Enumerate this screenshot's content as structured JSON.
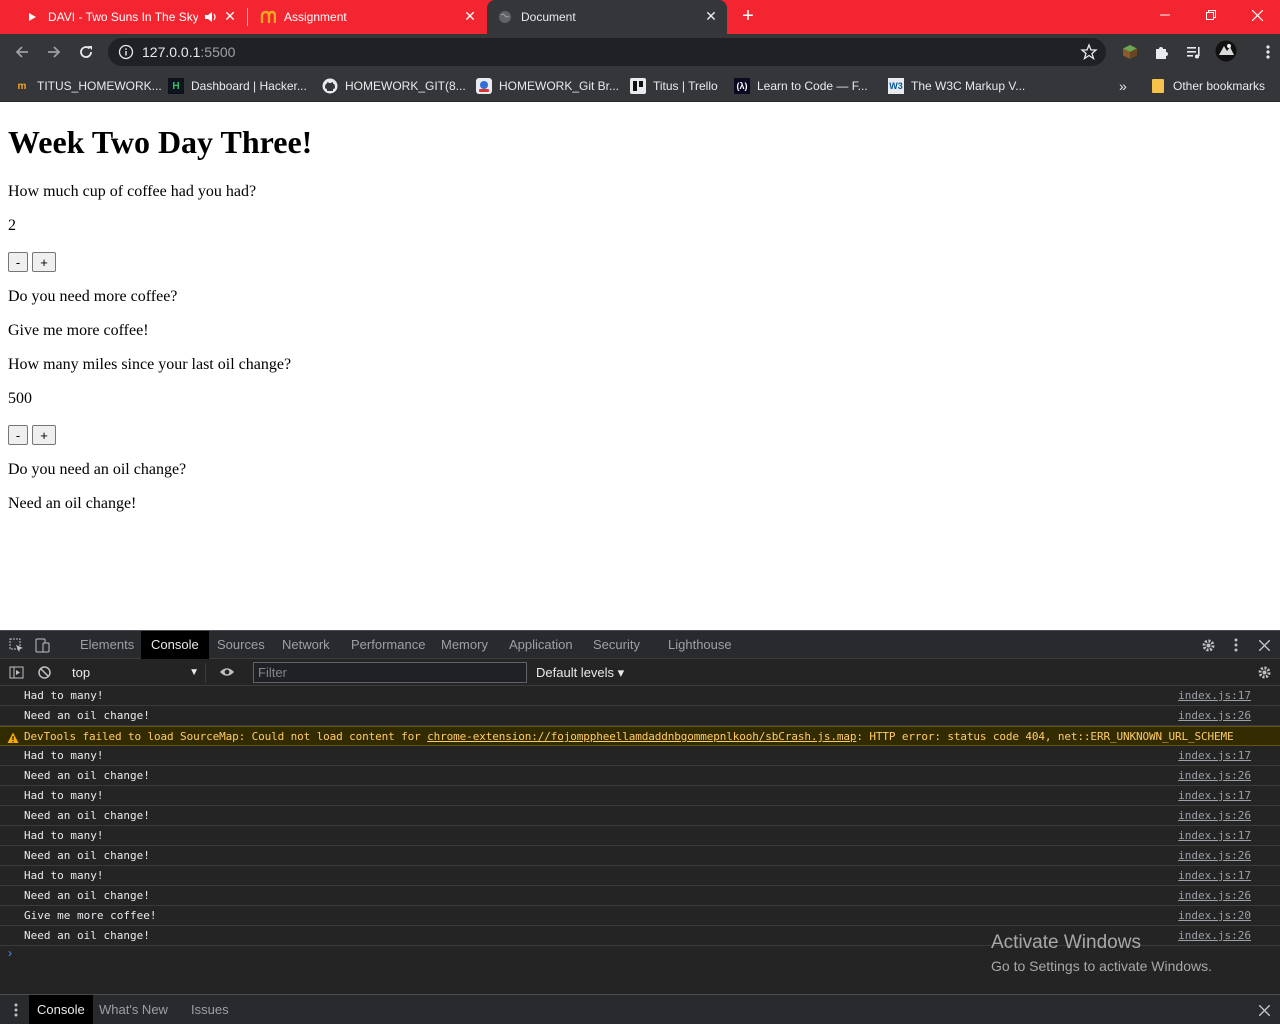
{
  "browser": {
    "tabs": [
      {
        "title": "DAVI - Two Suns In The Sky (",
        "icon": "youtube-icon",
        "audio": "speaker-icon"
      },
      {
        "title": "Assignment",
        "icon": "hackerrank-icon"
      },
      {
        "title": "Document",
        "icon": "globe-icon",
        "active": true
      }
    ],
    "address": {
      "host": "127.0.0.1",
      "port": ":5500"
    },
    "bookmarks": [
      {
        "label": "TITUS_HOMEWORK...",
        "icon": "m-logo-icon"
      },
      {
        "label": "Dashboard | Hacker...",
        "icon": "hackerrank-icon"
      },
      {
        "label": "HOMEWORK_GIT(8...",
        "icon": "github-icon"
      },
      {
        "label": "HOMEWORK_Git Br...",
        "icon": "discord-icon"
      },
      {
        "label": "Titus | Trello",
        "icon": "trello-icon"
      },
      {
        "label": "Learn to Code — F...",
        "icon": "freecodecamp-icon"
      },
      {
        "label": "The W3C Markup V...",
        "icon": "w3c-icon"
      }
    ],
    "overflow": "»",
    "other_bookmarks": "Other bookmarks"
  },
  "page": {
    "heading": "Week Two Day Three!",
    "coffee": {
      "question": "How much cup of coffee had you had?",
      "value": "2",
      "minus": "-",
      "plus": "+",
      "prompt": "Do you need more coffee?",
      "answer": "Give me more coffee!"
    },
    "oil": {
      "question": "How many miles since your last oil change?",
      "value": "500",
      "minus": "-",
      "plus": "+",
      "prompt": "Do you need an oil change?",
      "answer": "Need an oil change!"
    }
  },
  "devtools": {
    "tabs": [
      "Elements",
      "Console",
      "Sources",
      "Network",
      "Performance",
      "Memory",
      "Application",
      "Security",
      "Lighthouse"
    ],
    "active_tab": "Console",
    "context": "top",
    "filter_placeholder": "Filter",
    "levels": "Default levels ▾",
    "logs": [
      {
        "text": "Had to many!",
        "source": "index.js:17"
      },
      {
        "text": "Need an oil change!",
        "source": "index.js:26"
      },
      {
        "text": "DevTools failed to load SourceMap: Could not load content for ",
        "link": "chrome-extension://fojomppheellamdaddnbgommepnlkooh/sbCrash.js.map",
        "tail": ": HTTP error: status code 404, net::ERR_UNKNOWN_URL_SCHEME",
        "level": "warning"
      },
      {
        "text": "Had to many!",
        "source": "index.js:17"
      },
      {
        "text": "Need an oil change!",
        "source": "index.js:26"
      },
      {
        "text": "Had to many!",
        "source": "index.js:17"
      },
      {
        "text": "Need an oil change!",
        "source": "index.js:26"
      },
      {
        "text": "Had to many!",
        "source": "index.js:17"
      },
      {
        "text": "Need an oil change!",
        "source": "index.js:26"
      },
      {
        "text": "Had to many!",
        "source": "index.js:17"
      },
      {
        "text": "Need an oil change!",
        "source": "index.js:26"
      },
      {
        "text": "Give me more coffee!",
        "source": "index.js:20"
      },
      {
        "text": "Need an oil change!",
        "source": "index.js:26"
      }
    ],
    "drawer_tabs": [
      "Console",
      "What's New",
      "Issues"
    ],
    "drawer_active": "Console"
  },
  "watermark": {
    "line1": "Activate Windows",
    "line2": "Go to Settings to activate Windows."
  }
}
